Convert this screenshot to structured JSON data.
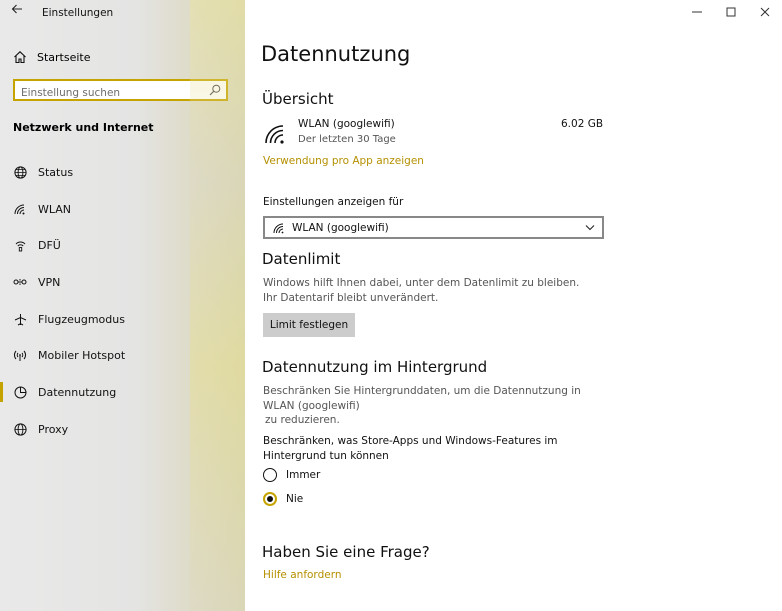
{
  "window": {
    "title": "Einstellungen",
    "minimize": "—",
    "maximize": "☐",
    "close": "✕"
  },
  "sidebar": {
    "home_label": "Startseite",
    "search_placeholder": "Einstellung suchen",
    "section_title": "Netzwerk und Internet",
    "items": [
      {
        "label": "Status",
        "icon": "globe-icon"
      },
      {
        "label": "WLAN",
        "icon": "wifi-icon"
      },
      {
        "label": "DFÜ",
        "icon": "dialup-icon"
      },
      {
        "label": "VPN",
        "icon": "vpn-icon"
      },
      {
        "label": "Flugzeugmodus",
        "icon": "airplane-icon"
      },
      {
        "label": "Mobiler Hotspot",
        "icon": "hotspot-icon"
      },
      {
        "label": "Datennutzung",
        "icon": "data-usage-icon",
        "active": true
      },
      {
        "label": "Proxy",
        "icon": "proxy-icon"
      }
    ]
  },
  "main": {
    "title": "Datennutzung",
    "overview": {
      "heading": "Übersicht",
      "network_name": "WLAN (googlewifi)",
      "period": "Der letzten 30 Tage",
      "usage": "6.02 GB",
      "per_app_link": "Verwendung pro App anzeigen"
    },
    "show_settings_for": {
      "label": "Einstellungen anzeigen für",
      "selected": "WLAN (googlewifi)"
    },
    "data_limit": {
      "heading": "Datenlimit",
      "description": "Windows hilft Ihnen dabei, unter dem Datenlimit zu bleiben. Ihr Datentarif bleibt unverändert.",
      "button": "Limit festlegen"
    },
    "background": {
      "heading": "Datennutzung im Hintergrund",
      "description_line1": "Beschränken Sie Hintergrunddaten, um die Datennutzung in WLAN (googlewifi)",
      "description_line2": "zu reduzieren.",
      "restrict_label": "Beschränken, was Store-Apps und Windows-Features im Hintergrund tun können",
      "options": [
        {
          "label": "Immer",
          "selected": false
        },
        {
          "label": "Nie",
          "selected": true
        }
      ]
    },
    "help": {
      "heading": "Haben Sie eine Frage?",
      "link": "Hilfe anfordern"
    }
  },
  "colors": {
    "accent": "#c6a400",
    "link": "#b59000",
    "button_bg": "#cccccc"
  }
}
